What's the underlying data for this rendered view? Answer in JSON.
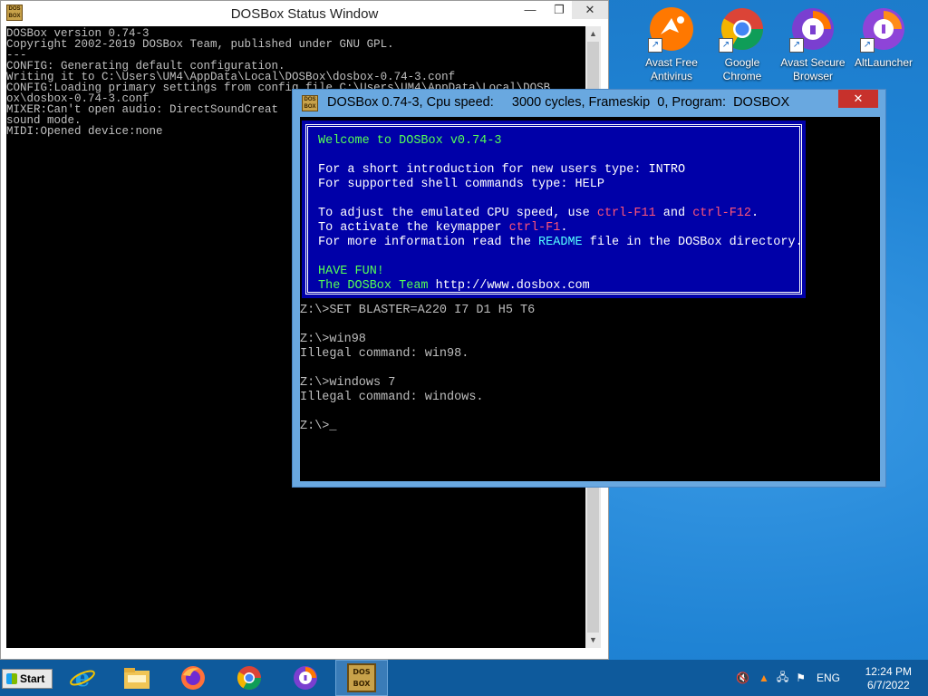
{
  "status_window": {
    "title": "DOSBox Status Window",
    "lines": [
      "DOSBox version 0.74-3",
      "Copyright 2002-2019 DOSBox Team, published under GNU GPL.",
      "---",
      "CONFIG: Generating default configuration.",
      "Writing it to C:\\Users\\UM4\\AppData\\Local\\DOSBox\\dosbox-0.74-3.conf",
      "CONFIG:Loading primary settings from config file C:\\Users\\UM4\\AppData\\Local\\DOSB",
      "ox\\dosbox-0.74-3.conf",
      "MIXER:Can't open audio: DirectSoundCreat",
      "sound mode.",
      "MIDI:Opened device:none"
    ],
    "buttons": {
      "minimize": "—",
      "restore": "❐",
      "close": "✕"
    }
  },
  "dosbox_window": {
    "logo_text": "DOS BOX",
    "title": "DOSBox 0.74-3, Cpu speed:     3000 cycles, Frameskip  0, Program:  DOSBOX",
    "close": "✕",
    "banner": {
      "welcome": "Welcome to DOSBox v0.74-3",
      "intro": "For a short introduction for new users type: INTRO",
      "help": "For supported shell commands type: HELP",
      "cpu_pre": "To adjust the emulated CPU speed, use ",
      "cpu_key1": "ctrl-F11",
      "cpu_mid": " and ",
      "cpu_key2": "ctrl-F12",
      "cpu_end": ".",
      "keymap_pre": "To activate the keymapper ",
      "keymap_key": "ctrl-F1",
      "keymap_end": ".",
      "info_pre": "For more information read the ",
      "info_link": "README",
      "info_end": " file in the DOSBox directory.",
      "fun": "HAVE FUN!",
      "team_pre": "The DOSBox Team ",
      "team_url": "http://www.dosbox.com"
    },
    "console_lines": [
      "Z:\\>SET BLASTER=A220 I7 D1 H5 T6",
      "",
      "Z:\\>win98",
      "Illegal command: win98.",
      "",
      "Z:\\>windows 7",
      "Illegal command: windows.",
      "",
      "Z:\\>_"
    ]
  },
  "desktop_icons": [
    {
      "label": "Avast Free Antivirus",
      "icon": "avast-icon"
    },
    {
      "label": "Google Chrome",
      "icon": "chrome-icon"
    },
    {
      "label": "Avast Secure Browser",
      "icon": "avast-browser-icon"
    },
    {
      "label": "AltLauncher",
      "icon": "altlauncher-icon"
    }
  ],
  "taskbar": {
    "start_label": "Start",
    "items": [
      "internet-explorer-icon",
      "file-explorer-icon",
      "firefox-icon",
      "chrome-icon",
      "avast-browser-icon",
      "dosbox-icon"
    ],
    "lang": "ENG",
    "time": "12:24 PM",
    "date": "6/7/2022"
  }
}
